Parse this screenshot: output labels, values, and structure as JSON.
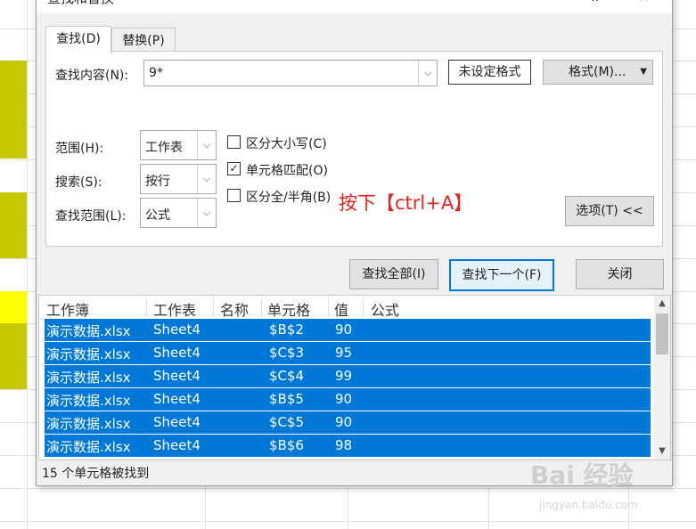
{
  "dialog": {
    "title": "查找和替换",
    "close_icon": "×",
    "minimize_hint": "‥"
  },
  "tabs": [
    {
      "label": "查找(D)"
    },
    {
      "label": "替换(P)"
    }
  ],
  "find": {
    "label": "查找内容(N):",
    "value": "9*",
    "format_preview": "未设定格式",
    "format_button": "格式(M)..."
  },
  "options": {
    "scope_label": "范围(H):",
    "scope_value": "工作表",
    "search_label": "搜索(S):",
    "search_value": "按行",
    "lookin_label": "查找范围(L):",
    "lookin_value": "公式",
    "match_case": {
      "label": "区分大小写(C)",
      "checked": false
    },
    "match_cell": {
      "label": "单元格匹配(O)",
      "checked": true
    },
    "match_width": {
      "label": "区分全/半角(B)",
      "checked": false
    },
    "options_button": "选项(T) <<"
  },
  "annotation": "按下【ctrl+A】",
  "buttons": {
    "find_all": "查找全部(I)",
    "find_next": "查找下一个(F)",
    "close": "关闭"
  },
  "results": {
    "headers": [
      "工作簿",
      "工作表",
      "名称",
      "单元格",
      "值",
      "公式"
    ],
    "rows": [
      {
        "book": "演示数据.xlsx",
        "sheet": "Sheet4",
        "name": "",
        "cell": "$B$2",
        "value": "90"
      },
      {
        "book": "演示数据.xlsx",
        "sheet": "Sheet4",
        "name": "",
        "cell": "$C$3",
        "value": "95"
      },
      {
        "book": "演示数据.xlsx",
        "sheet": "Sheet4",
        "name": "",
        "cell": "$C$4",
        "value": "99"
      },
      {
        "book": "演示数据.xlsx",
        "sheet": "Sheet4",
        "name": "",
        "cell": "$B$5",
        "value": "90"
      },
      {
        "book": "演示数据.xlsx",
        "sheet": "Sheet4",
        "name": "",
        "cell": "$C$5",
        "value": "90"
      },
      {
        "book": "演示数据.xlsx",
        "sheet": "Sheet4",
        "name": "",
        "cell": "$B$6",
        "value": "98"
      }
    ]
  },
  "status": "15 个单元格被找到",
  "watermark": {
    "main": "Bai 经验",
    "sub": "jingyan.baidu.com"
  },
  "colors": {
    "selection": "#0078d7",
    "cell_fill_olive": "#c8c800",
    "cell_fill_yellow": "#ffff00",
    "annotation": "#e8231e"
  }
}
